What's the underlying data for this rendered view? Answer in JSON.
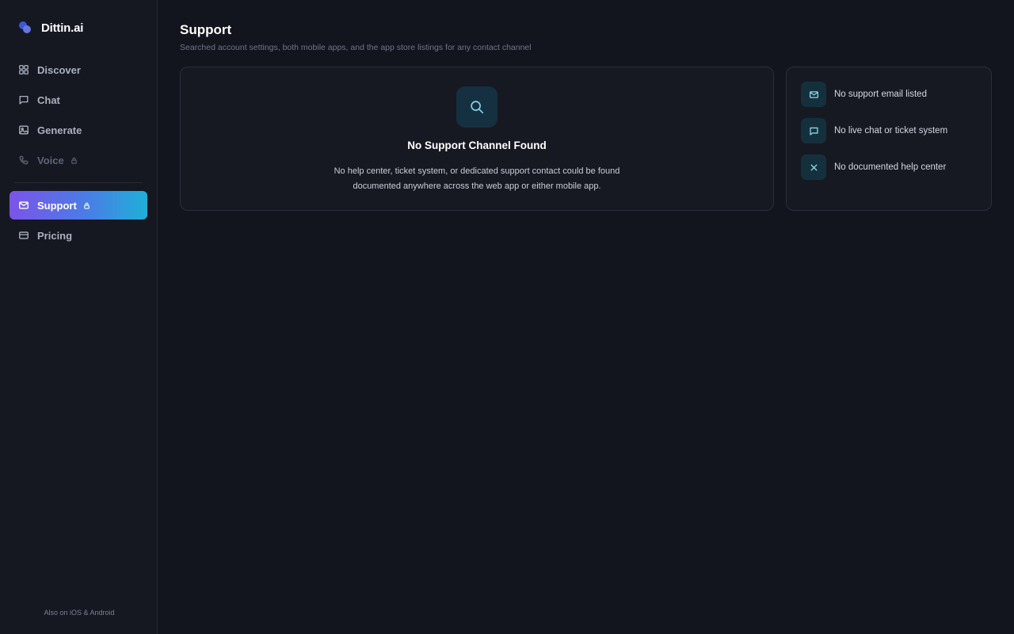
{
  "brand": {
    "name": "Dittin.ai"
  },
  "sidebar": {
    "items": [
      {
        "label": "Discover",
        "icon": "grid-icon"
      },
      {
        "label": "Chat",
        "icon": "chat-icon"
      },
      {
        "label": "Generate",
        "icon": "image-icon"
      },
      {
        "label": "Voice",
        "icon": "phone-icon",
        "locked": true,
        "disabled": true
      },
      {
        "label": "Support",
        "icon": "mail-icon",
        "locked": true,
        "active": true
      },
      {
        "label": "Pricing",
        "icon": "card-icon"
      }
    ],
    "footer": "Also on iOS & Android"
  },
  "page": {
    "title": "Support",
    "subtitle": "Searched account settings, both mobile apps, and the app store listings for any contact channel"
  },
  "main_card": {
    "icon": "search-icon",
    "title": "No Support Channel Found",
    "description": "No help center, ticket system, or dedicated support contact could be found documented anywhere across the web app or either mobile app."
  },
  "side_card": {
    "items": [
      {
        "icon": "mail-icon",
        "label": "No support email listed"
      },
      {
        "icon": "chat-icon",
        "label": "No live chat or ticket system"
      },
      {
        "icon": "close-icon",
        "label": "No documented help center"
      }
    ]
  },
  "colors": {
    "background": "#13151e",
    "sidebar": "#161821",
    "accent_gradient_start": "#7b54e8",
    "accent_gradient_end": "#1fb0d8",
    "icon_tint": "#7fd4ea"
  }
}
